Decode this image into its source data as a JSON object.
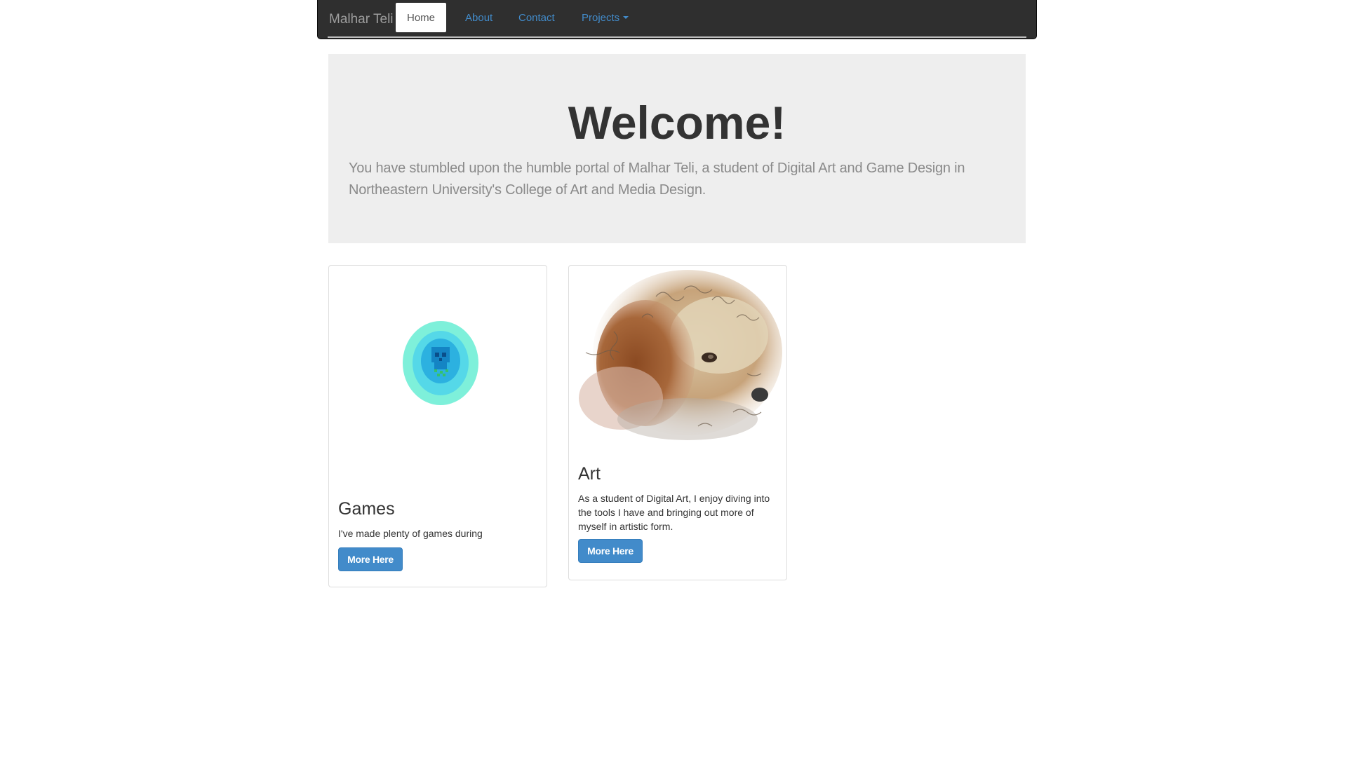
{
  "navbar": {
    "brand": "Malhar Teli",
    "items": [
      {
        "label": "Home"
      },
      {
        "label": "About"
      },
      {
        "label": "Contact"
      },
      {
        "label": "Projects"
      }
    ]
  },
  "jumbotron": {
    "heading": "Welcome!",
    "text": "You have stumbled upon the humble portal of Malhar Teli, a student of Digital Art and Game Design in Northeastern University's College of Art and Media Design."
  },
  "cards": [
    {
      "title": "Games",
      "text": "I've made plenty of games during",
      "button": "More Here",
      "image_icon": "pixel-skull-icon"
    },
    {
      "title": "Art",
      "text": "As a student of Digital Art, I enjoy diving into the tools I have and bringing out more of myself in artistic form.",
      "button": "More Here",
      "image_icon": "dog-sketch-image"
    }
  ],
  "colors": {
    "navbar_bg": "#2f2f2f",
    "link": "#428bca",
    "jumbotron_bg": "#eeeeee",
    "button": "#428bca"
  }
}
